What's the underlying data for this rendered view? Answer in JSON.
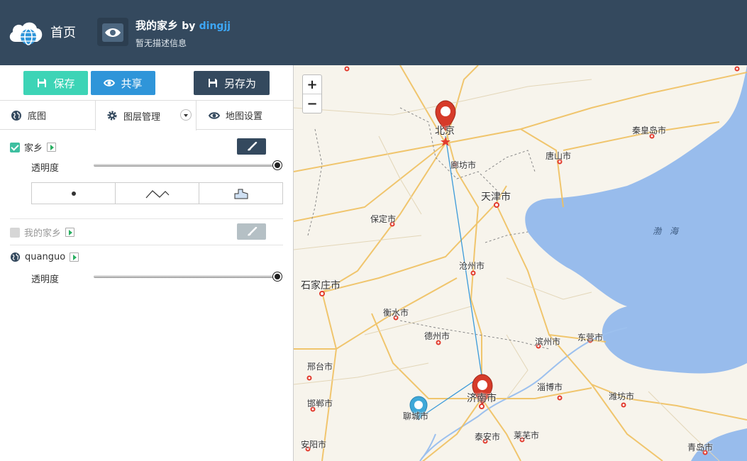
{
  "header": {
    "home_label": "首页",
    "project_title": "我的家乡",
    "project_by": "by",
    "project_author": "dingjj",
    "project_desc": "暂无描述信息"
  },
  "toolbar": {
    "save_label": "保存",
    "share_label": "共享",
    "save_as_label": "另存为"
  },
  "tabs": {
    "basemap": "底图",
    "layers": "图层管理",
    "settings": "地图设置"
  },
  "layers": [
    {
      "name": "家乡",
      "checked": true,
      "opacity_label": "透明度",
      "opacity": 1.0
    },
    {
      "name": "我的家乡",
      "checked": false
    },
    {
      "name": "quanguo",
      "opacity_label": "透明度",
      "opacity": 1.0
    }
  ],
  "zoom": {
    "in": "+",
    "out": "−"
  },
  "map_labels": {
    "beijing": "北京",
    "langfang": "廊坊市",
    "tianjin": "天津市",
    "qinhuangdao": "秦皇岛市",
    "tangshan": "唐山市",
    "baoding": "保定市",
    "bohai": "渤 海",
    "cangzhou": "沧州市",
    "shijiazhuang": "石家庄市",
    "hengshui": "衡水市",
    "dezhou": "德州市",
    "binzhou": "滨州市",
    "dongying": "东营市",
    "xingtai": "邢台市",
    "jinan": "济南市",
    "zibo": "淄博市",
    "weifang": "潍坊市",
    "handan": "邯郸市",
    "liaocheng": "聊城市",
    "taian": "泰安市",
    "laiwu": "莱芜市",
    "anyang": "安阳市",
    "qingdao": "青岛市"
  },
  "colors": {
    "header_bg": "#34495e",
    "save_btn": "#3dd4b6",
    "share_btn": "#2f95d9",
    "save_as_btn": "#34495e",
    "marker_red": "#d63b2a",
    "marker_blue": "#3fa8d8",
    "route_line": "#3b9ad9",
    "sea": "#98bcec"
  }
}
